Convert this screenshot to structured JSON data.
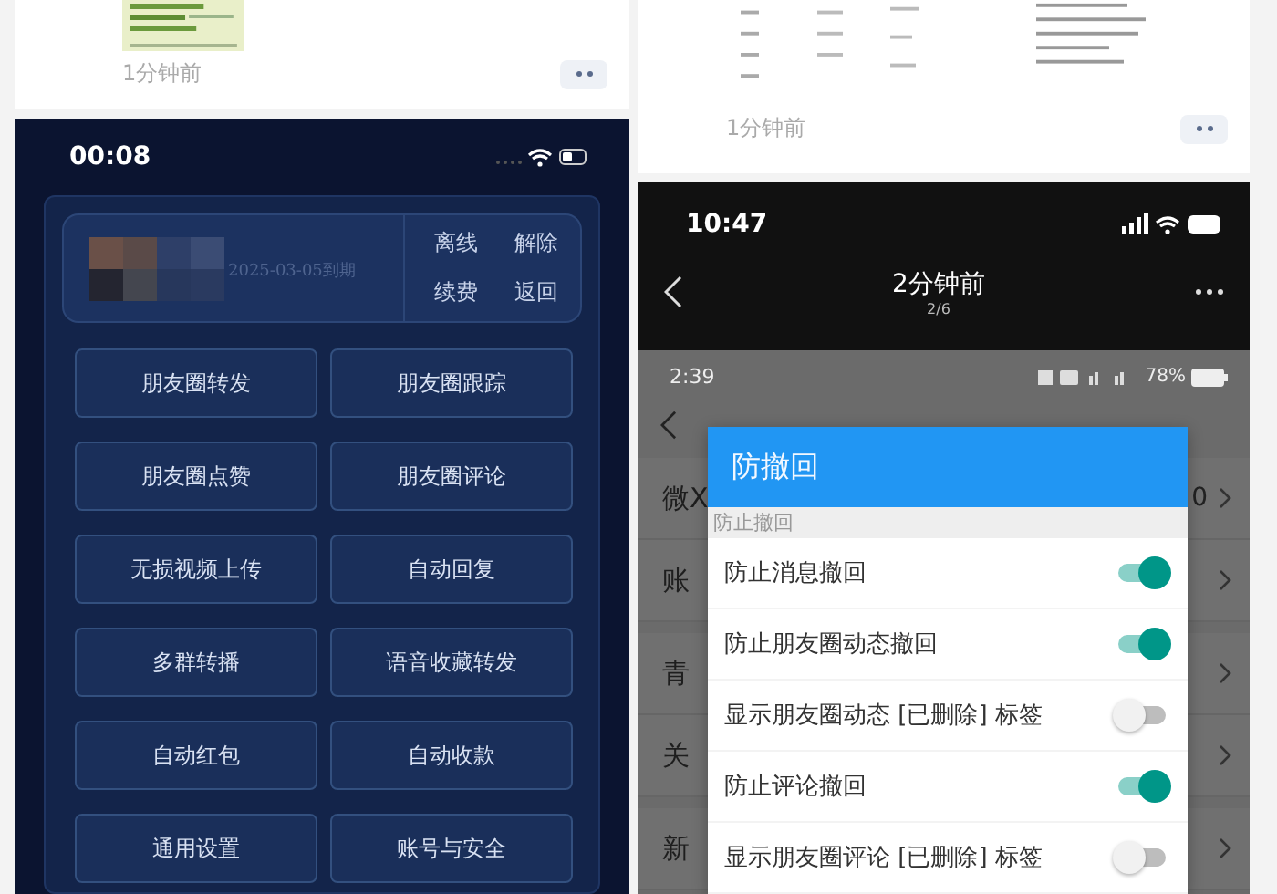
{
  "left_post": {
    "kind": "picture",
    "time": "1分钟前"
  },
  "phone": {
    "status_time": "00:08",
    "account": {
      "kind": "picture",
      "expiry": "2025-03-05到期",
      "actions": [
        "离线",
        "解除",
        "续费",
        "返回"
      ]
    },
    "buttons": [
      "朋友圈转发",
      "朋友圈跟踪",
      "朋友圈点赞",
      "朋友圈评论",
      "无损视频上传",
      "自动回复",
      "多群转播",
      "语音收藏转发",
      "自动红包",
      "自动收款",
      "通用设置",
      "账号与安全"
    ]
  },
  "right_post": {
    "kind": "picture",
    "time": "1分钟前"
  },
  "viewer": {
    "status_time": "10:47",
    "title": "2分钟前",
    "counter": "2/6",
    "screen": {
      "status_time": "2:39",
      "battery": "78%",
      "rows": [
        {
          "label": "微X",
          "value": "0"
        },
        {
          "label": "账"
        },
        {
          "label": "青"
        },
        {
          "label": "关"
        },
        {
          "label": "新"
        }
      ],
      "dialog": {
        "title": "防撤回",
        "section": "防止撤回",
        "options": [
          {
            "label": "防止消息撤回",
            "on": true
          },
          {
            "label": "防止朋友圈动态撤回",
            "on": true
          },
          {
            "label": "显示朋友圈动态 [已删除] 标签",
            "on": false
          },
          {
            "label": "防止评论撤回",
            "on": true
          },
          {
            "label": "显示朋友圈评论 [已删除] 标签",
            "on": false
          }
        ]
      }
    }
  }
}
